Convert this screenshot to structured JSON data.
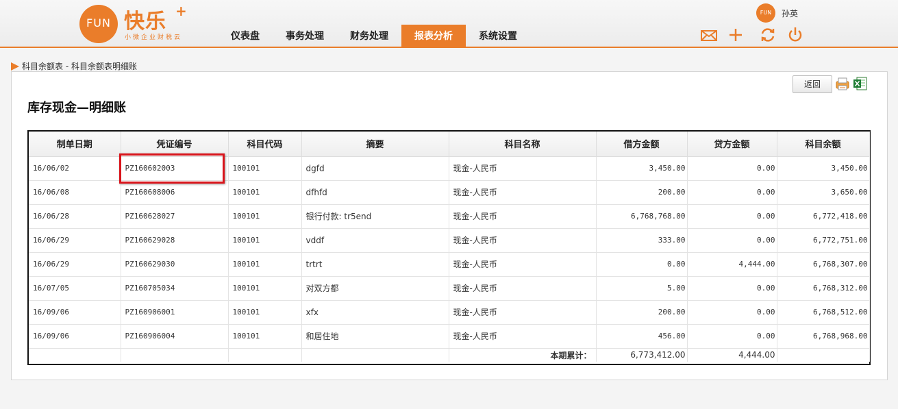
{
  "brand": {
    "logo_text": "FUN",
    "title": "快乐",
    "plus": "+",
    "subtitle": "小微企业财税云"
  },
  "nav": [
    {
      "label": "仪表盘",
      "active": false
    },
    {
      "label": "事务处理",
      "active": false
    },
    {
      "label": "财务处理",
      "active": false
    },
    {
      "label": "报表分析",
      "active": true
    },
    {
      "label": "系统设置",
      "active": false
    }
  ],
  "user": {
    "avatar_text": "FUN",
    "name": "孙英"
  },
  "header_icons": [
    "mail-icon",
    "plus-icon",
    "refresh-icon",
    "power-icon"
  ],
  "breadcrumb": {
    "text": "科目余额表 - 科目余额表明细账"
  },
  "toolbar": {
    "back_label": "返回",
    "print_icon": "print-icon",
    "excel_icon": "excel-export-icon"
  },
  "page_title": "库存现金—明细账",
  "table": {
    "columns": [
      "制单日期",
      "凭证编号",
      "科目代码",
      "摘要",
      "科目名称",
      "借方金额",
      "贷方金额",
      "科目余额"
    ],
    "rows": [
      [
        "16/06/02",
        "PZ160602003",
        "100101",
        "dgfd",
        "现金-人民币",
        "3,450.00",
        "0.00",
        "3,450.00"
      ],
      [
        "16/06/08",
        "PZ160608006",
        "100101",
        "dfhfd",
        "现金-人民币",
        "200.00",
        "0.00",
        "3,650.00"
      ],
      [
        "16/06/28",
        "PZ160628027",
        "100101",
        "银行付款: tr5end",
        "现金-人民币",
        "6,768,768.00",
        "0.00",
        "6,772,418.00"
      ],
      [
        "16/06/29",
        "PZ160629028",
        "100101",
        "vddf",
        "现金-人民币",
        "333.00",
        "0.00",
        "6,772,751.00"
      ],
      [
        "16/06/29",
        "PZ160629030",
        "100101",
        "trtrt",
        "现金-人民币",
        "0.00",
        "4,444.00",
        "6,768,307.00"
      ],
      [
        "16/07/05",
        "PZ160705034",
        "100101",
        "对双方都",
        "现金-人民币",
        "5.00",
        "0.00",
        "6,768,312.00"
      ],
      [
        "16/09/06",
        "PZ160906001",
        "100101",
        "xfx",
        "现金-人民币",
        "200.00",
        "0.00",
        "6,768,512.00"
      ],
      [
        "16/09/06",
        "PZ160906004",
        "100101",
        "和居住地",
        "现金-人民币",
        "456.00",
        "0.00",
        "6,768,968.00"
      ]
    ],
    "total": {
      "label": "本期累计：",
      "debit": "6,773,412.00",
      "credit": "4,444.00"
    }
  },
  "colors": {
    "accent": "#ea7d2a",
    "highlight": "#d9141b"
  }
}
